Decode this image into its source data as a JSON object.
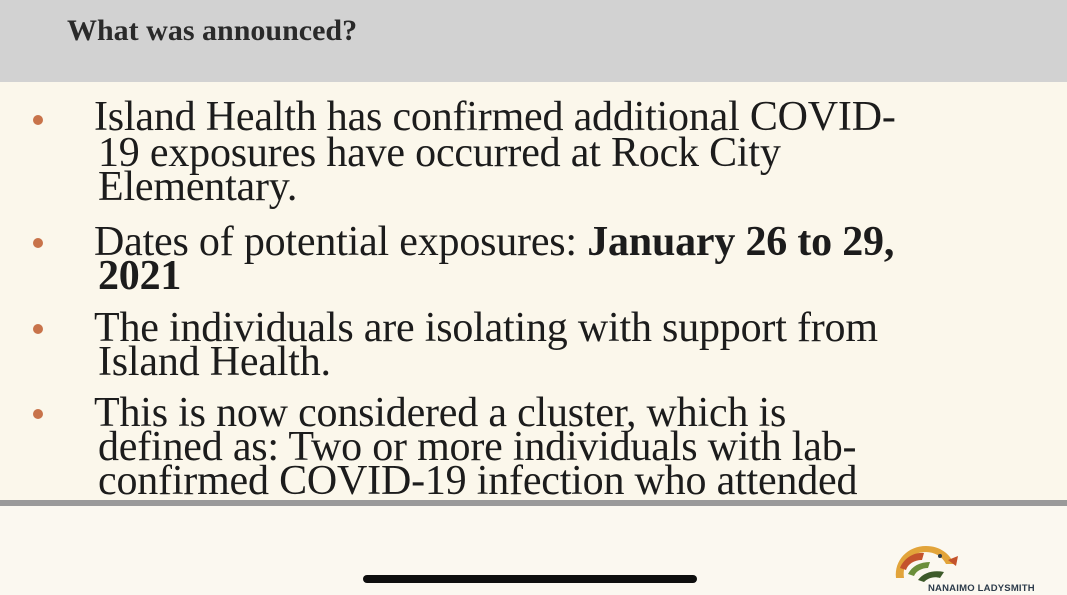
{
  "header": {
    "title": "What was announced?"
  },
  "bullets": [
    {
      "lines": [
        "Island Health has confirmed additional COVID-",
        "19 exposures have occurred at Rock City",
        "Elementary."
      ]
    },
    {
      "line1_prefix": "Dates of potential exposures: ",
      "line1_bold": "January 26 to 29,",
      "line2_bold": "2021"
    },
    {
      "lines": [
        "The individuals are isolating with support from",
        "Island Health."
      ]
    },
    {
      "lines": [
        "This is now considered a cluster, which is",
        "defined as: Two or more individuals with lab-",
        "confirmed COVID-19 infection who attended"
      ]
    }
  ],
  "logo": {
    "text": "NANAIMO LADYSMITH",
    "icon": "salmon-logo-icon",
    "colors": [
      "#e2a43a",
      "#c4532c",
      "#6b8f3a",
      "#3d5a2a"
    ]
  },
  "colors": {
    "header_bg": "#d2d2d2",
    "body_bg": "#fbf7eb",
    "bullet": "#c8734a",
    "home_indicator": "#0e0e0e"
  }
}
